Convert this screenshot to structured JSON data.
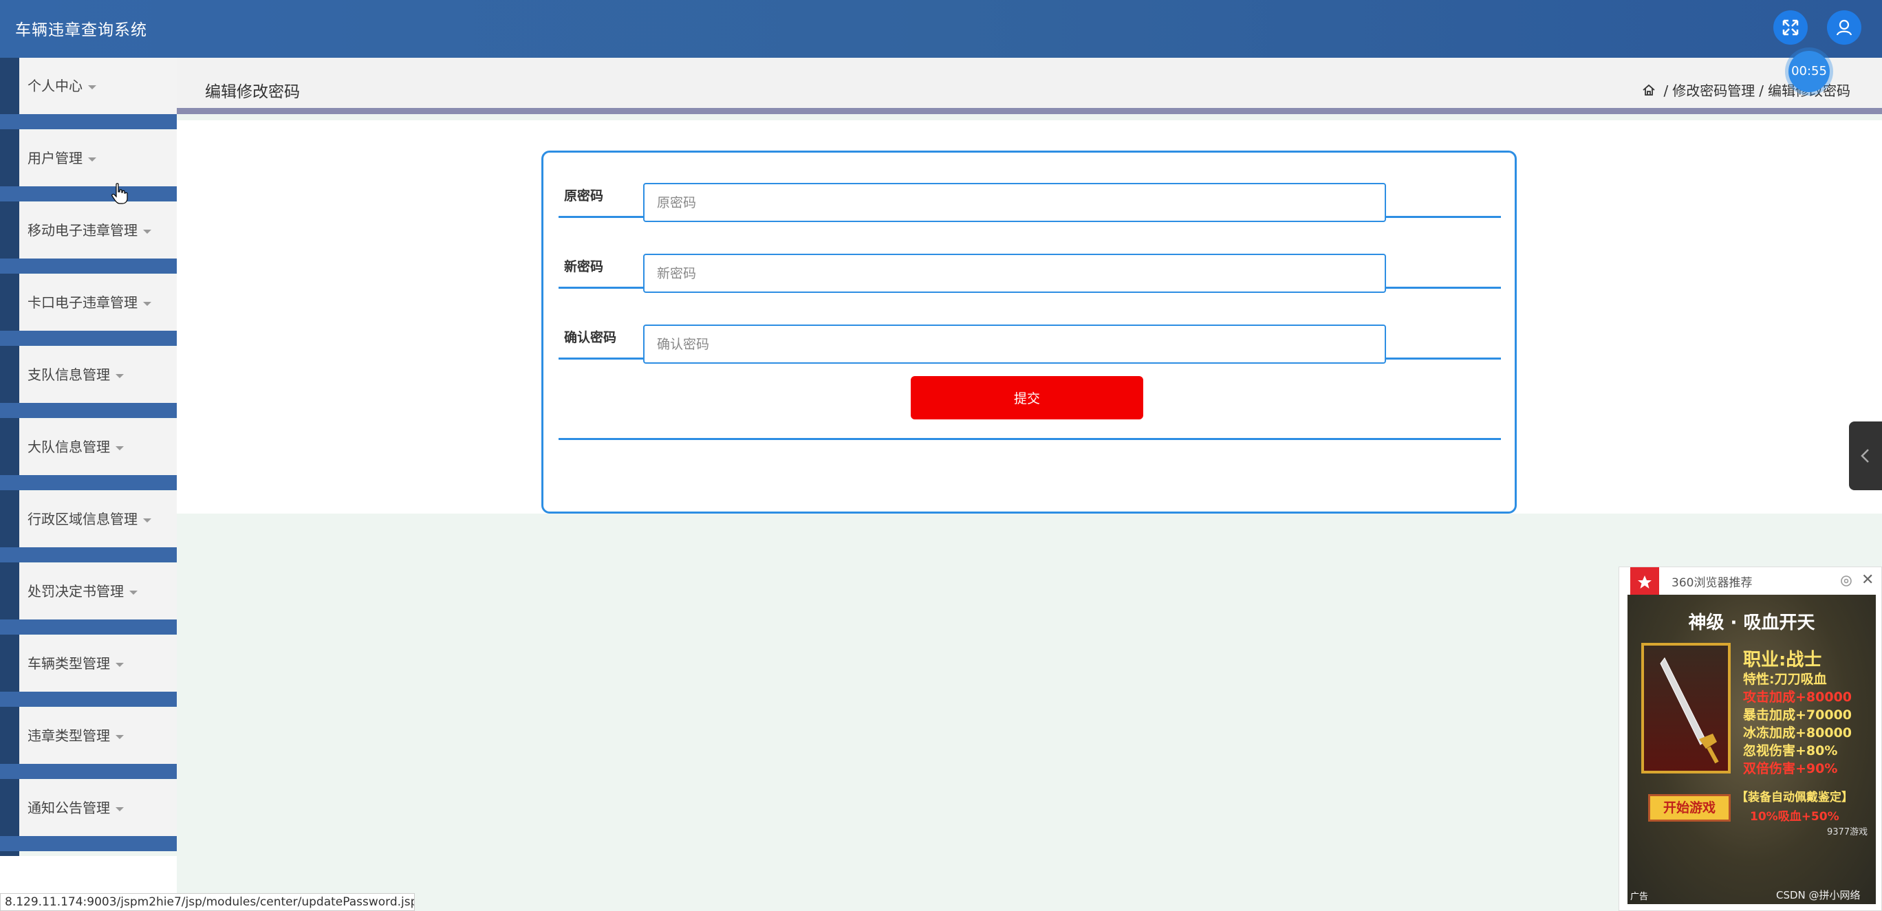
{
  "header": {
    "app_title": "车辆违章查询系统",
    "fullscreen_button": "expand-icon",
    "user_button": "user-icon",
    "accent_color": "#3467a8"
  },
  "sidebar": {
    "items": [
      {
        "label": "个人中心"
      },
      {
        "label": "用户管理"
      },
      {
        "label": "移动电子违章管理"
      },
      {
        "label": "卡口电子违章管理"
      },
      {
        "label": "支队信息管理"
      },
      {
        "label": "大队信息管理"
      },
      {
        "label": "行政区域信息管理"
      },
      {
        "label": "处罚决定书管理"
      },
      {
        "label": "车辆类型管理"
      },
      {
        "label": "违章类型管理"
      },
      {
        "label": "通知公告管理"
      }
    ]
  },
  "page": {
    "title": "编辑修改密码",
    "breadcrumb": {
      "home_icon": "home-icon",
      "item1": "修改密码管理",
      "item2": "编辑修改密码",
      "separator": "/"
    },
    "timer": "00:55"
  },
  "form": {
    "fields": [
      {
        "label": "原密码",
        "placeholder": "原密码",
        "value": ""
      },
      {
        "label": "新密码",
        "placeholder": "新密码",
        "value": ""
      },
      {
        "label": "确认密码",
        "placeholder": "确认密码",
        "value": ""
      }
    ],
    "submit_label": "提交",
    "submit_color": "#f20000",
    "border_color": "#2d8ee3"
  },
  "ad": {
    "header_text": "360浏览器推荐",
    "title": "神级 · 吸血开天",
    "class": "职业:战士",
    "stats": [
      {
        "text": "特性:刀刀吸血",
        "color": "yellow"
      },
      {
        "text": "攻击加成+80000",
        "color": "red"
      },
      {
        "text": "暴击加成+70000",
        "color": "yellow"
      },
      {
        "text": "冰冻加成+80000",
        "color": "yellow"
      },
      {
        "text": "忽视伤害+80%",
        "color": "yellow"
      },
      {
        "text": "双倍伤害+90%",
        "color": "red"
      }
    ],
    "play_button": "开始游戏",
    "auto_text": "【装备自动佩戴鉴定】",
    "suck_text": "10%吸血+50%",
    "brand": "9377游戏",
    "ad_label": "广告",
    "watermark": "CSDN @拼小网络"
  },
  "status_bar": {
    "url": "8.129.11.174:9003/jspm2hie7/jsp/modules/center/updatePassword.jsp#"
  }
}
